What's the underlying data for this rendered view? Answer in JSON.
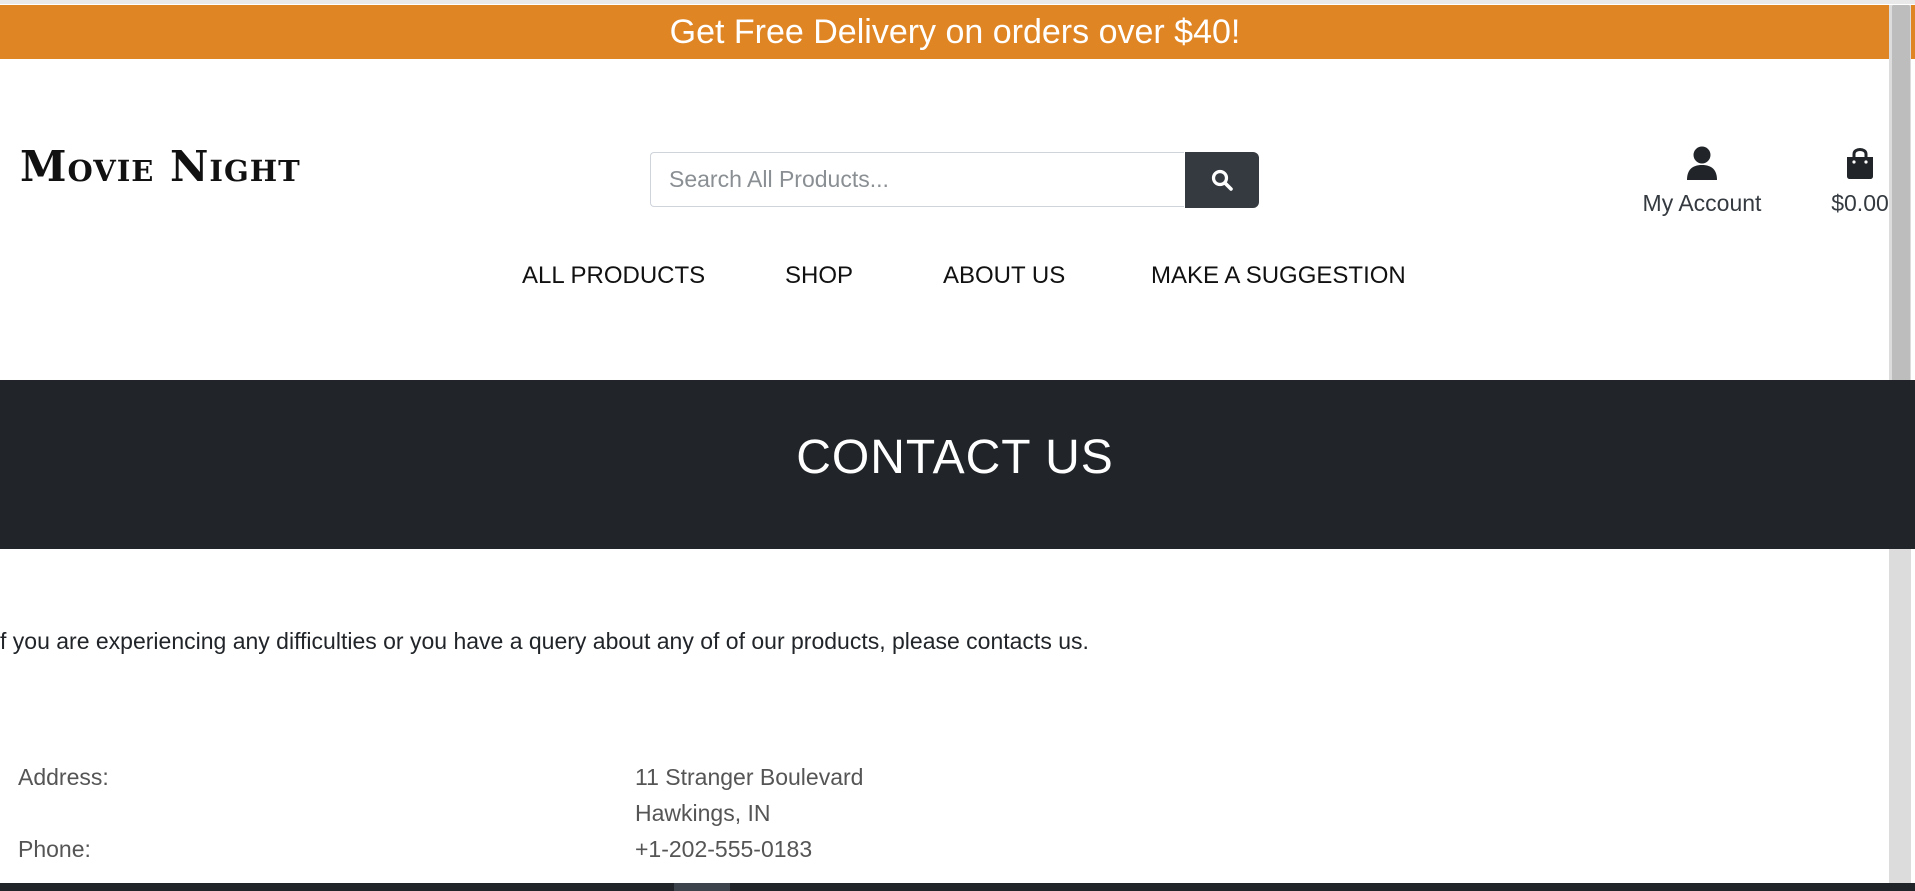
{
  "banner": {
    "text": "Get Free Delivery on orders over $40!",
    "color": "#e08524"
  },
  "header": {
    "logo": "Movie Night",
    "search": {
      "placeholder": "Search All Products...",
      "value": "",
      "icon": "search-icon"
    },
    "account": {
      "label": "My Account",
      "icon": "user-icon"
    },
    "bag": {
      "total": "$0.00",
      "icon": "shopping-bag-icon"
    }
  },
  "nav": {
    "items": [
      {
        "label": "ALL PRODUCTS"
      },
      {
        "label": "SHOP"
      },
      {
        "label": "ABOUT US"
      },
      {
        "label": "MAKE A SUGGESTION"
      }
    ]
  },
  "hero": {
    "title": "CONTACT US",
    "background": "#212529"
  },
  "main": {
    "intro": "f you are experiencing any difficulties or you have a query about any of of our products, please contacts us.",
    "address_label": "Address:",
    "address_line1": "11 Stranger Boulevard",
    "address_line2": "Hawkings, IN",
    "phone_label": "Phone:",
    "phone_value": "+1-202-555-0183"
  }
}
